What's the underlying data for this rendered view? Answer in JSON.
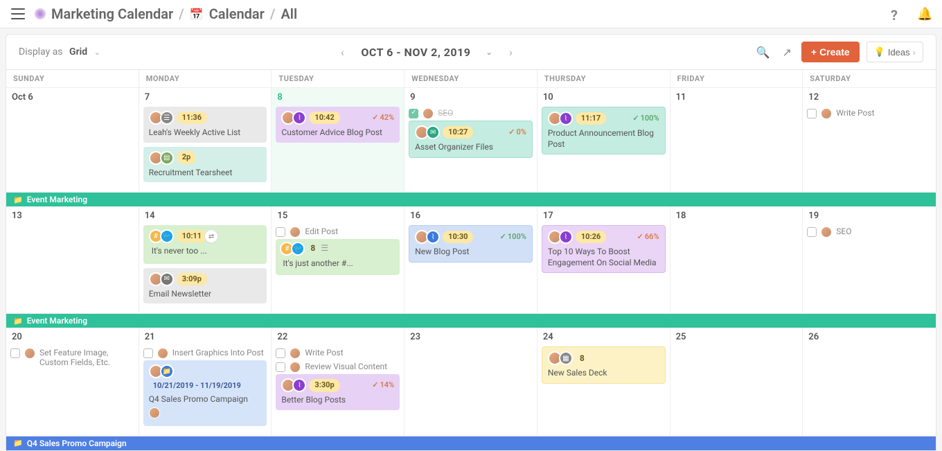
{
  "breadcrumb": {
    "root": "Marketing Calendar",
    "mid": "Calendar",
    "leaf": "All"
  },
  "toolbar": {
    "display_label": "Display as",
    "display_value": "Grid",
    "range": "OCT 6 - NOV 2, 2019",
    "create": "Create",
    "ideas": "Ideas"
  },
  "dow": [
    "SUNDAY",
    "MONDAY",
    "TUESDAY",
    "WEDNESDAY",
    "THURSDAY",
    "FRIDAY",
    "SATURDAY"
  ],
  "week1": {
    "sun": "Oct 6",
    "mon": {
      "num": "7",
      "c1": {
        "time": "11:36",
        "title": "Leah's Weekly Active List"
      },
      "c2": {
        "time": "2p",
        "title": "Recruitment Tearsheet"
      }
    },
    "tue": {
      "num": "8",
      "c1": {
        "time": "10:42",
        "pct": "42%",
        "title": "Customer Advice Blog Post"
      }
    },
    "wed": {
      "num": "9",
      "t1": "SEO",
      "c1": {
        "time": "10:27",
        "pct": "0%",
        "title": "Asset Organizer Files"
      }
    },
    "thu": {
      "num": "10",
      "c1": {
        "time": "11:17",
        "pct": "100%",
        "title": "Product Announcement Blog Post"
      }
    },
    "fri": "11",
    "sat": {
      "num": "12",
      "t1": "Write Post"
    }
  },
  "band1": "Event Marketing",
  "week2": {
    "sun": "13",
    "mon": {
      "num": "14",
      "c1": {
        "time": "10:11",
        "title": "It's never too ..."
      },
      "c2": {
        "time": "3:09p",
        "title": "Email Newsletter"
      }
    },
    "tue": {
      "num": "15",
      "t1": "Edit Post",
      "c1": {
        "count": "8",
        "title": "It's just another #..."
      }
    },
    "wed": {
      "num": "16",
      "c1": {
        "time": "10:30",
        "pct": "100%",
        "title": "New Blog Post"
      }
    },
    "thu": {
      "num": "17",
      "c1": {
        "time": "10:26",
        "pct": "66%",
        "title": "Top 10 Ways To Boost Engagement On Social Media"
      }
    },
    "fri": "18",
    "sat": {
      "num": "19",
      "t1": "SEO"
    }
  },
  "band2": "Event Marketing",
  "week3": {
    "sun": {
      "num": "20",
      "t1": "Set Feature Image, Custom Fields, Etc."
    },
    "mon": {
      "num": "21",
      "t1": "Insert Graphics Into Post",
      "c1": {
        "dates": "10/21/2019 - 11/19/2019",
        "title": "Q4 Sales Promo Campaign"
      }
    },
    "tue": {
      "num": "22",
      "t1": "Write Post",
      "t2": "Review Visual Content",
      "c1": {
        "time": "3:30p",
        "pct": "14%",
        "title": "Better Blog Posts"
      }
    },
    "wed": "23",
    "thu": {
      "num": "24",
      "c1": {
        "count": "8",
        "title": "New Sales Deck"
      }
    },
    "fri": "25",
    "sat": "26"
  },
  "band3": "Q4 Sales Promo Campaign"
}
